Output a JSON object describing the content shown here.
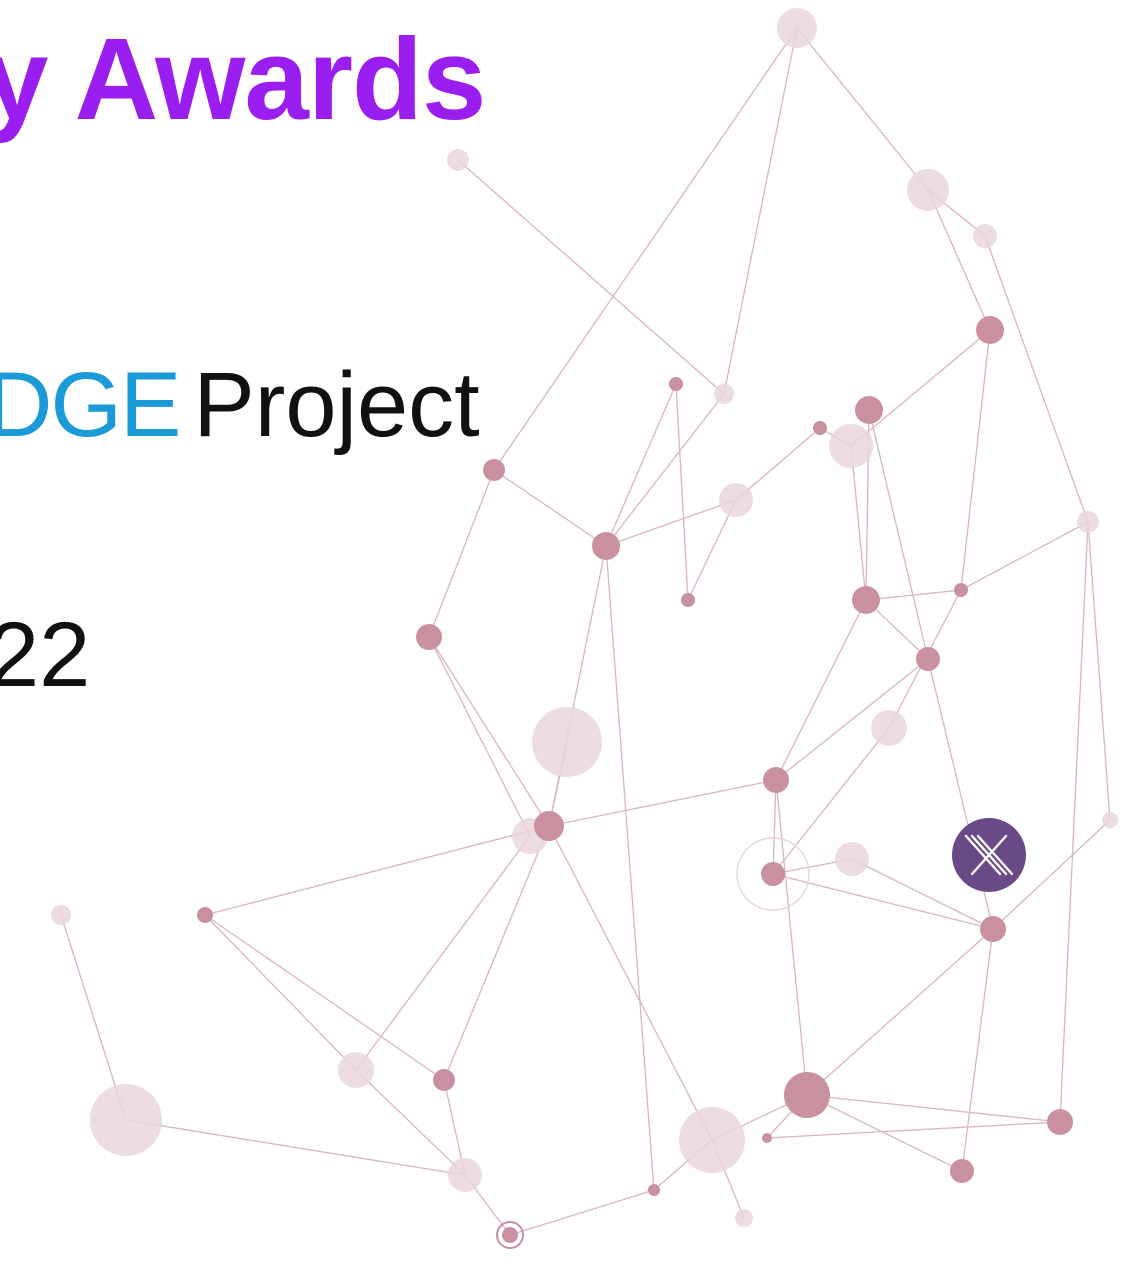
{
  "slide": {
    "title": "y Awards",
    "project_brand": "DGE",
    "project_word": "Project",
    "year_fragment": "22"
  },
  "colors": {
    "title": "#9b1ef0",
    "brand": "#1a9ad6",
    "body_text": "#111111",
    "node": "#c9909f",
    "node_light": "#ead6dc",
    "edge": "#d9b5c0",
    "badge": "#6a4a86"
  },
  "icons": {
    "badge": "x-logo-icon",
    "background": "network-graph-icon"
  }
}
